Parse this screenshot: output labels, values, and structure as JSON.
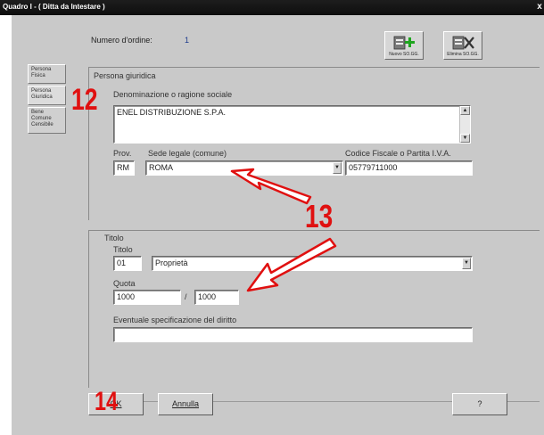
{
  "window": {
    "title": "Quadro I - ( Ditta da Intestare )",
    "close_label": "x"
  },
  "header": {
    "order_label": "Numero d'ordine:",
    "order_value": "1"
  },
  "toolbar": [
    {
      "label": "Nuovo SO.GG.",
      "icon": "new-record-icon"
    },
    {
      "label": "Elimina SO.GG.",
      "icon": "delete-record-icon"
    }
  ],
  "tabs": [
    {
      "label": "Persona Fisica"
    },
    {
      "label": "Persona Giuridica"
    },
    {
      "label": "Bene Comune Censibile"
    }
  ],
  "persona_giuridica": {
    "section_title": "Persona giuridica",
    "denominazione_label": "Denominazione o ragione sociale",
    "denominazione_value": "ENEL DISTRIBUZIONE S.P.A.",
    "prov_label": "Prov.",
    "prov_value": "RM",
    "sede_label": "Sede legale (comune)",
    "sede_value": "ROMA",
    "cf_label": "Codice Fiscale o Partita I.V.A.",
    "cf_value": "05779711000"
  },
  "titolo": {
    "section_title": "Titolo",
    "titolo_label": "Titolo",
    "titolo_code": "01",
    "titolo_value": "Proprietà",
    "quota_label": "Quota",
    "quota_num": "1000",
    "quota_sep": "/",
    "quota_den": "1000",
    "spec_label": "Eventuale specificazione del diritto",
    "spec_value": ""
  },
  "footer": {
    "ok_label": "OK",
    "annulla_label": "Annulla",
    "help_label": "?"
  },
  "annotations": {
    "a12": "12",
    "a13": "13",
    "a14": "14"
  },
  "colors": {
    "annotation": "#e01010",
    "window_bg": "#c9c9c9",
    "titlebar": "#111111"
  }
}
